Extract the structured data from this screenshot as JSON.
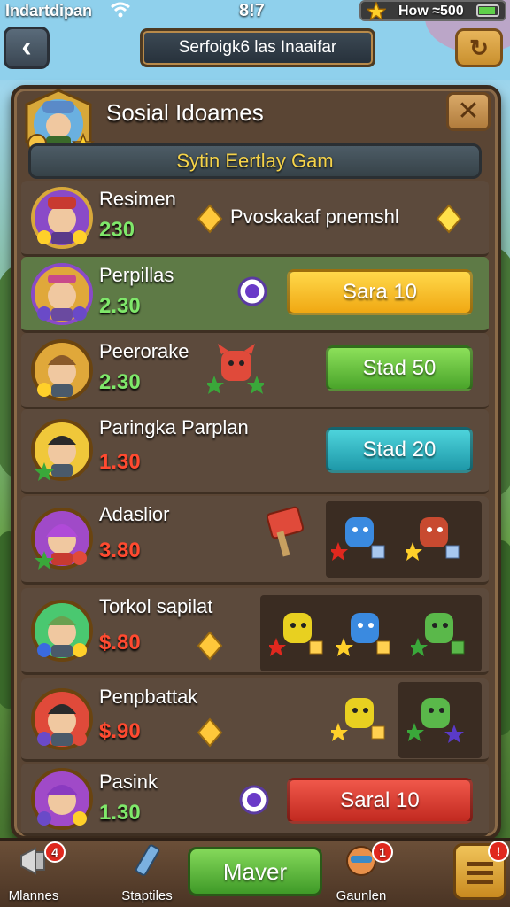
{
  "status": {
    "carrier": "Indartdipan",
    "time": "8!7",
    "battery_text": "How ≈500"
  },
  "topbar": {
    "title": "Serfoigk6 las Inaaifar"
  },
  "panel": {
    "title": "Sosial Idoames",
    "subtitle": "Sytin Eertlay Gam"
  },
  "rows": [
    {
      "name": "Resimen",
      "score": "230",
      "score_color": "green",
      "reward_text": "Pvoskakaf pnemshl"
    },
    {
      "name": "Perpillas",
      "score": "2.30",
      "score_color": "green",
      "button": "Sara 10",
      "button_color": "yellow"
    },
    {
      "name": "Peerorake",
      "score": "2.30",
      "score_color": "green",
      "button": "Stad 50",
      "button_color": "green"
    },
    {
      "name": "Paringka Parplan",
      "score": "1.30",
      "score_color": "red",
      "button": "Stad 20",
      "button_color": "teal"
    },
    {
      "name": "Adaslior",
      "score": "3.80",
      "score_color": "red"
    },
    {
      "name": "Torkol sapilat",
      "score": "$.80",
      "score_color": "red"
    },
    {
      "name": "Penpbattak",
      "score": "$.90",
      "score_color": "red"
    },
    {
      "name": "Pasink",
      "score": "1.30",
      "score_color": "green",
      "button": "Saral 10",
      "button_color": "red"
    }
  ],
  "nav": [
    {
      "label": "Mlannes",
      "icon": "megaphone-icon",
      "badge": "4"
    },
    {
      "label": "Staptiles",
      "icon": "pencil-icon"
    },
    {
      "label": "Maver",
      "primary": true
    },
    {
      "label": "Gaunlen",
      "icon": "character-icon",
      "badge": "1"
    },
    {
      "label": "",
      "icon": "menu-icon",
      "badge": "!"
    }
  ],
  "colors": {
    "gold": "#f5d34a",
    "panel": "#5a4534",
    "row_highlight": "#5e7a46",
    "score_green": "#7fe86a",
    "score_red": "#ff4a30"
  }
}
